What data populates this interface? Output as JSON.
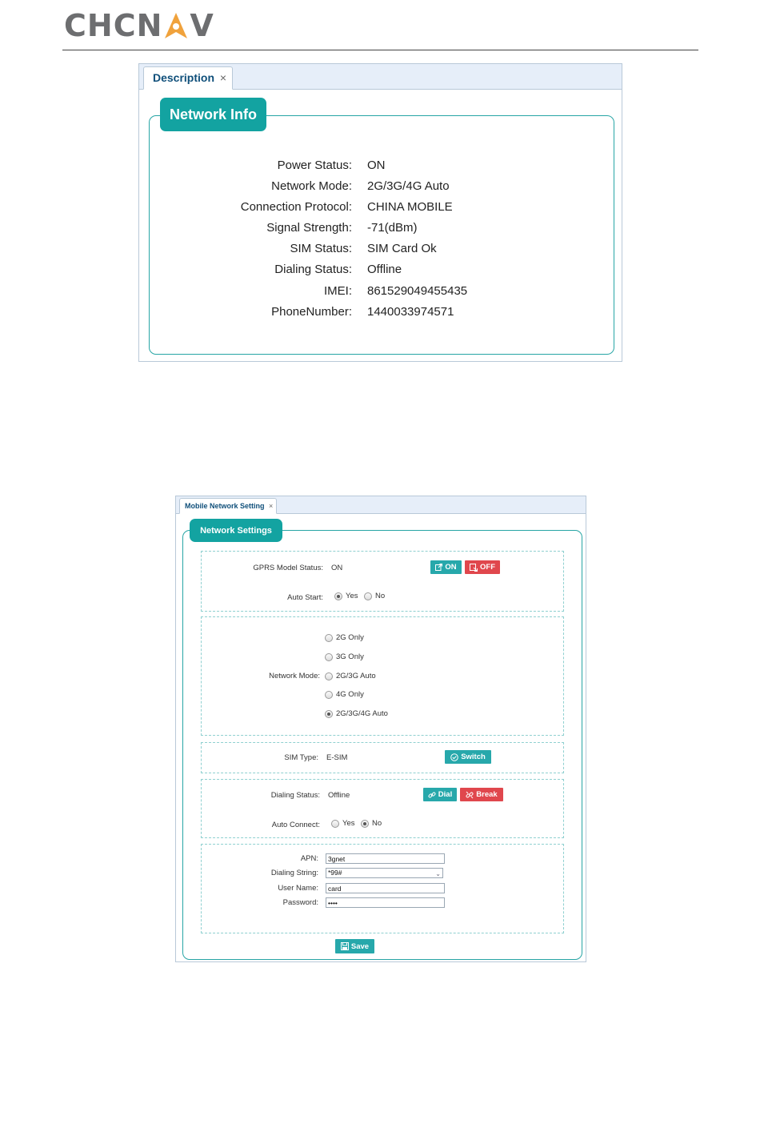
{
  "header": {
    "logo_text_left": "CHCN",
    "logo_text_right": "V"
  },
  "description_panel": {
    "tab_label": "Description",
    "tab_close": "×",
    "legend": "Network Info",
    "rows": [
      {
        "label": "Power Status:",
        "value": "ON"
      },
      {
        "label": "Network Mode:",
        "value": "2G/3G/4G Auto"
      },
      {
        "label": "Connection Protocol:",
        "value": "CHINA MOBILE"
      },
      {
        "label": "Signal Strength:",
        "value": "-71(dBm)"
      },
      {
        "label": "SIM Status:",
        "value": "SIM Card Ok"
      },
      {
        "label": "Dialing Status:",
        "value": "Offline"
      },
      {
        "label": "IMEI:",
        "value": "861529049455435"
      },
      {
        "label": "PhoneNumber:",
        "value": "1440033974571"
      }
    ]
  },
  "settings_panel": {
    "tab_label": "Mobile Network Setting",
    "tab_close": "×",
    "legend": "Network Settings",
    "gprs": {
      "label": "GPRS Model Status:",
      "value": "ON",
      "on_button": "ON",
      "off_button": "OFF",
      "auto_start_label": "Auto Start:",
      "yes": "Yes",
      "no": "No",
      "selected": "Yes"
    },
    "network_mode": {
      "label": "Network Mode:",
      "options": [
        "2G Only",
        "3G Only",
        "2G/3G Auto",
        "4G Only",
        "2G/3G/4G Auto"
      ],
      "selected": "2G/3G/4G Auto"
    },
    "sim": {
      "label": "SIM Type:",
      "value": "E-SIM",
      "switch_button": "Switch"
    },
    "dialing": {
      "label": "Dialing Status:",
      "value": "Offline",
      "dial_button": "Dial",
      "break_button": "Break",
      "auto_connect_label": "Auto Connect:",
      "yes": "Yes",
      "no": "No",
      "selected": "No"
    },
    "apn": {
      "apn_label": "APN:",
      "apn_value": "3gnet",
      "dial_string_label": "Dialing String:",
      "dial_string_value": "*99#",
      "user_label": "User Name:",
      "user_value": "card",
      "password_label": "Password:",
      "password_value": "••••"
    },
    "save_button": "Save"
  },
  "colors": {
    "teal": "#13a3a1",
    "red": "#e0474d",
    "logo_gray": "#6d6e70",
    "logo_orange": "#f0a23c"
  }
}
